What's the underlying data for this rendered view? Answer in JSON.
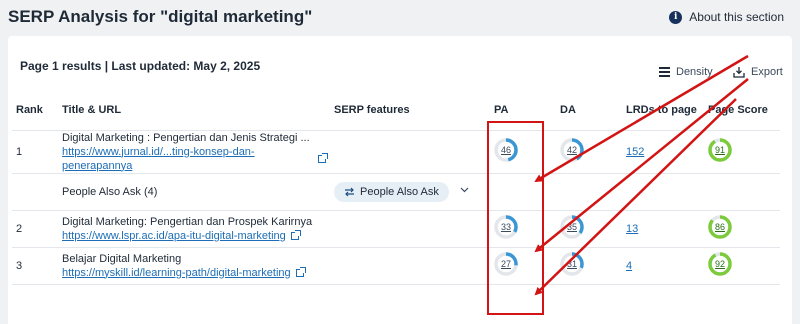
{
  "header": {
    "title": "SERP Analysis for \"digital marketing\"",
    "about_label": "About this section"
  },
  "card": {
    "subtitle": "Page 1 results | Last updated: May 2, 2025",
    "density_label": "Density",
    "export_label": "Export"
  },
  "table": {
    "columns": [
      "Rank",
      "Title & URL",
      "SERP features",
      "PA",
      "DA",
      "LRDs to page",
      "Page Score"
    ],
    "rows": [
      {
        "rank": "1",
        "title": "Digital Marketing : Pengertian dan Jenis Strategi ...",
        "url": "https://www.jurnal.id/...ting-konsep-dan-penerapannya",
        "pa": 46,
        "da": 42,
        "lrd": "152",
        "score": 91
      },
      {
        "rank": "",
        "title": "People Also Ask (4)",
        "url": "",
        "serp_feature": "People Also Ask"
      },
      {
        "rank": "2",
        "title": "Digital Marketing: Pengertian dan Prospek Karirnya",
        "url": "https://www.lspr.ac.id/apa-itu-digital-marketing",
        "pa": 33,
        "da": 35,
        "lrd": "13",
        "score": 86
      },
      {
        "rank": "3",
        "title": "Belajar Digital Marketing",
        "url": "https://myskill.id/learning-path/digital-marketing",
        "pa": 27,
        "da": 31,
        "lrd": "4",
        "score": 92
      }
    ]
  },
  "colors": {
    "gauge_blue": "#3b97d3",
    "gauge_track": "#e3e6ea",
    "score_green": "#7ccb3c",
    "highlight_red": "#d21414",
    "link": "#1c6db5"
  },
  "icons": {
    "about": "info-icon",
    "density": "density-lines-icon",
    "export": "download-icon",
    "paa": "swap-arrows-icon",
    "expand": "chevron-down-icon",
    "external": "external-link-icon"
  }
}
